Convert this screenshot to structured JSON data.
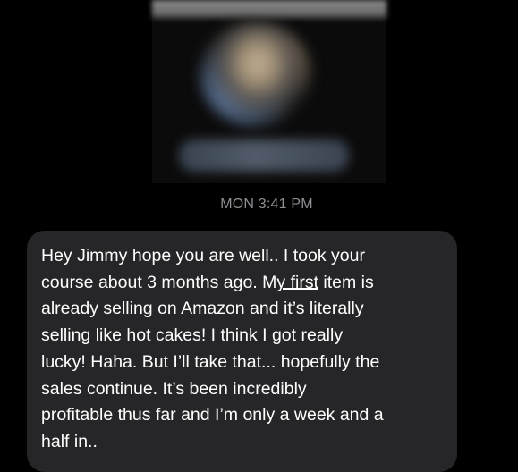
{
  "thread": {
    "timestamp": "MON 3:41 PM"
  },
  "messages": [
    {
      "sender": "incoming",
      "lines": [
        "Hey Jimmy hope you are well.. I took your",
        "course about 3 months ago. My first item is",
        "already selling on Amazon and it’s literally",
        "selling like hot cakes! I think I got really",
        "lucky! Haha. But I’ll take that... hopefully the",
        "sales continue. It’s been incredibly",
        "profitable thus far and I’m only a week and a",
        "half in.."
      ]
    }
  ],
  "colors": {
    "background": "#000000",
    "bubble": "#262628",
    "message_text": "#ffffff",
    "timestamp_text": "#8e8e93"
  }
}
